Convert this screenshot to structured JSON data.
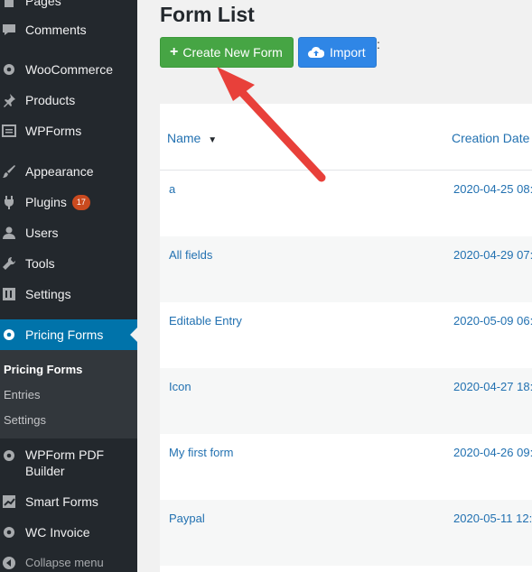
{
  "sidebar": {
    "items": [
      {
        "label": "Pages",
        "icon": "pages-icon"
      },
      {
        "label": "Comments",
        "icon": "comment-icon"
      },
      {
        "label": "WooCommerce",
        "icon": "gear-icon"
      },
      {
        "label": "Products",
        "icon": "pin-icon"
      },
      {
        "label": "WPForms",
        "icon": "form-icon"
      },
      {
        "label": "Appearance",
        "icon": "brush-icon"
      },
      {
        "label": "Plugins",
        "icon": "plugin-icon",
        "badge": "17"
      },
      {
        "label": "Users",
        "icon": "user-icon"
      },
      {
        "label": "Tools",
        "icon": "wrench-icon"
      },
      {
        "label": "Settings",
        "icon": "settings-icon"
      },
      {
        "label": "Pricing Forms",
        "icon": "gear-icon"
      },
      {
        "label": "WPForm PDF",
        "label2": "Builder",
        "icon": "gear-icon"
      },
      {
        "label": "Smart Forms",
        "icon": "chart-icon"
      },
      {
        "label": "WC Invoice",
        "icon": "gear-icon"
      },
      {
        "label": "Collapse menu",
        "icon": "collapse-icon"
      }
    ],
    "submenu": [
      "Pricing Forms",
      "Entries",
      "Settings"
    ]
  },
  "main": {
    "title": "Form List",
    "create_label": "Create New Form",
    "import_label": "Import",
    "stray": ":",
    "table": {
      "headers": {
        "name": "Name",
        "date": "Creation Date"
      },
      "rows": [
        {
          "name": "a",
          "date": "2020-04-25 08:"
        },
        {
          "name": "All fields",
          "date": "2020-04-29 07:"
        },
        {
          "name": "Editable Entry",
          "date": "2020-05-09 06:"
        },
        {
          "name": "Icon",
          "date": "2020-04-27 18:"
        },
        {
          "name": "My first form",
          "date": "2020-04-26 09:"
        },
        {
          "name": "Paypal",
          "date": "2020-05-11 12:"
        }
      ]
    }
  },
  "colors": {
    "sidebar": "#23282d",
    "current": "#0073aa",
    "create": "#46a544",
    "import": "#2f86e6",
    "arrow": "#e8403a"
  }
}
